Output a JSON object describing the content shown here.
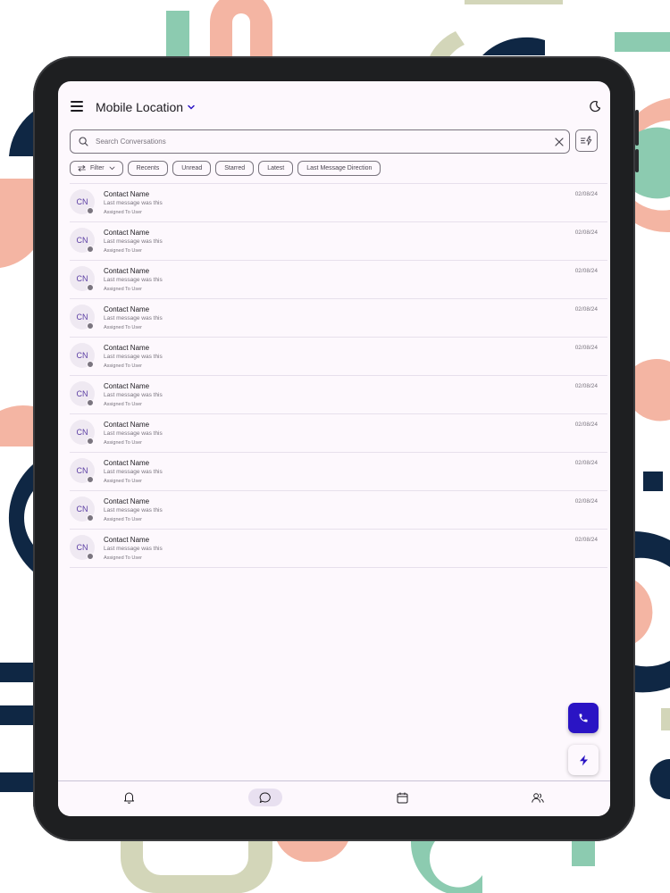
{
  "header": {
    "title": "Mobile Location",
    "title_dropdown_icon": "chevron-down-icon",
    "menu_icon": "hamburger-menu-icon",
    "theme_icon": "moon-icon"
  },
  "search": {
    "placeholder": "Search Conversations",
    "value": "",
    "clear_icon": "close-icon",
    "action_icon": "filter-flash-icon"
  },
  "filters": {
    "filter_label": "Filter",
    "chips": [
      "Recents",
      "Unread",
      "Starred",
      "Latest",
      "Last Message Direction"
    ]
  },
  "conversations": [
    {
      "initials": "CN",
      "name": "Contact Name",
      "last_message": "Last message was this",
      "assigned": "Assigned To User",
      "date": "02/08/24"
    },
    {
      "initials": "CN",
      "name": "Contact Name",
      "last_message": "Last message was this",
      "assigned": "Assigned To User",
      "date": "02/08/24"
    },
    {
      "initials": "CN",
      "name": "Contact Name",
      "last_message": "Last message was this",
      "assigned": "Assigned To User",
      "date": "02/08/24"
    },
    {
      "initials": "CN",
      "name": "Contact Name",
      "last_message": "Last message was this",
      "assigned": "Assigned To User",
      "date": "02/08/24"
    },
    {
      "initials": "CN",
      "name": "Contact Name",
      "last_message": "Last message was this",
      "assigned": "Assigned To User",
      "date": "02/08/24"
    },
    {
      "initials": "CN",
      "name": "Contact Name",
      "last_message": "Last message was this",
      "assigned": "Assigned To User",
      "date": "02/08/24"
    },
    {
      "initials": "CN",
      "name": "Contact Name",
      "last_message": "Last message was this",
      "assigned": "Assigned To User",
      "date": "02/08/24"
    },
    {
      "initials": "CN",
      "name": "Contact Name",
      "last_message": "Last message was this",
      "assigned": "Assigned To User",
      "date": "02/08/24"
    },
    {
      "initials": "CN",
      "name": "Contact Name",
      "last_message": "Last message was this",
      "assigned": "Assigned To User",
      "date": "02/08/24"
    },
    {
      "initials": "CN",
      "name": "Contact Name",
      "last_message": "Last message was this",
      "assigned": "Assigned To User",
      "date": "02/08/24"
    }
  ],
  "fabs": {
    "call_icon": "phone-icon",
    "quick_icon": "lightning-icon"
  },
  "bottom_nav": {
    "items": [
      "bell-icon",
      "chat-bubble-icon",
      "calendar-icon",
      "contacts-icon"
    ],
    "active": "chat-bubble-icon"
  },
  "colors": {
    "accent": "#2a14c4",
    "screen_bg": "#fdf8fd",
    "frame": "#1e1f21",
    "avatar_bg": "#efe9f2",
    "avatar_text": "#5b3ea3",
    "decor_navy": "#0f2744",
    "decor_salmon": "#f4b5a3",
    "decor_mint": "#8ccbb0",
    "decor_sage": "#d3d6b9"
  }
}
